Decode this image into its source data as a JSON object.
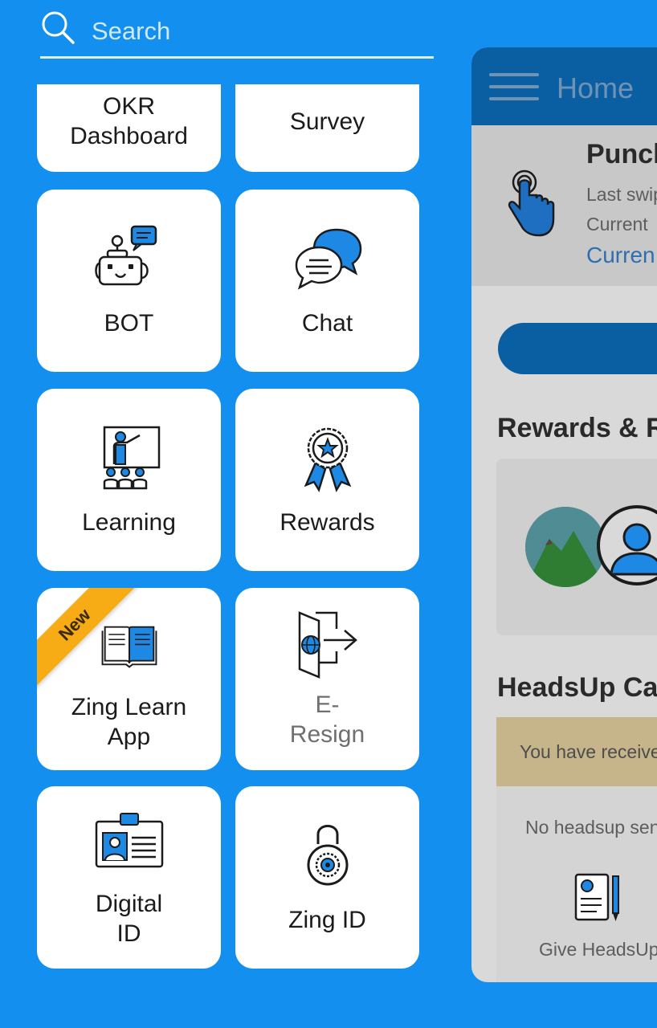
{
  "search": {
    "placeholder": "Search"
  },
  "tiles": [
    {
      "label": "OKR\nDashboard",
      "icon": "okr-dashboard-icon"
    },
    {
      "label": "Survey",
      "icon": "survey-icon"
    },
    {
      "label": "BOT",
      "icon": "bot-icon"
    },
    {
      "label": "Chat",
      "icon": "chat-icon"
    },
    {
      "label": "Learning",
      "icon": "learning-icon"
    },
    {
      "label": "Rewards",
      "icon": "rewards-icon"
    },
    {
      "label": "Zing Learn\nApp",
      "icon": "book-icon",
      "badge": "New"
    },
    {
      "label": "E-\nResign",
      "icon": "exit-door-icon"
    },
    {
      "label": "Digital\nID",
      "icon": "id-card-icon"
    },
    {
      "label": "Zing ID",
      "icon": "lock-icon"
    }
  ],
  "background_app": {
    "header_title": "Home",
    "punch_title": "Punch",
    "last_swipe": "Last swip",
    "current_label": "Current",
    "current_link": "Curren",
    "rewards_heading": "Rewards & R",
    "headsup_heading": "HeadsUp Ca",
    "received_text": "You have receive",
    "no_headsup_text": "No headsup sen",
    "give_headsup": "Give HeadsUp"
  },
  "colors": {
    "background": "#138ff0",
    "accent_blue": "#1e88e5",
    "ribbon": "#f7ab14",
    "header_dim": "#0a5fa3"
  }
}
